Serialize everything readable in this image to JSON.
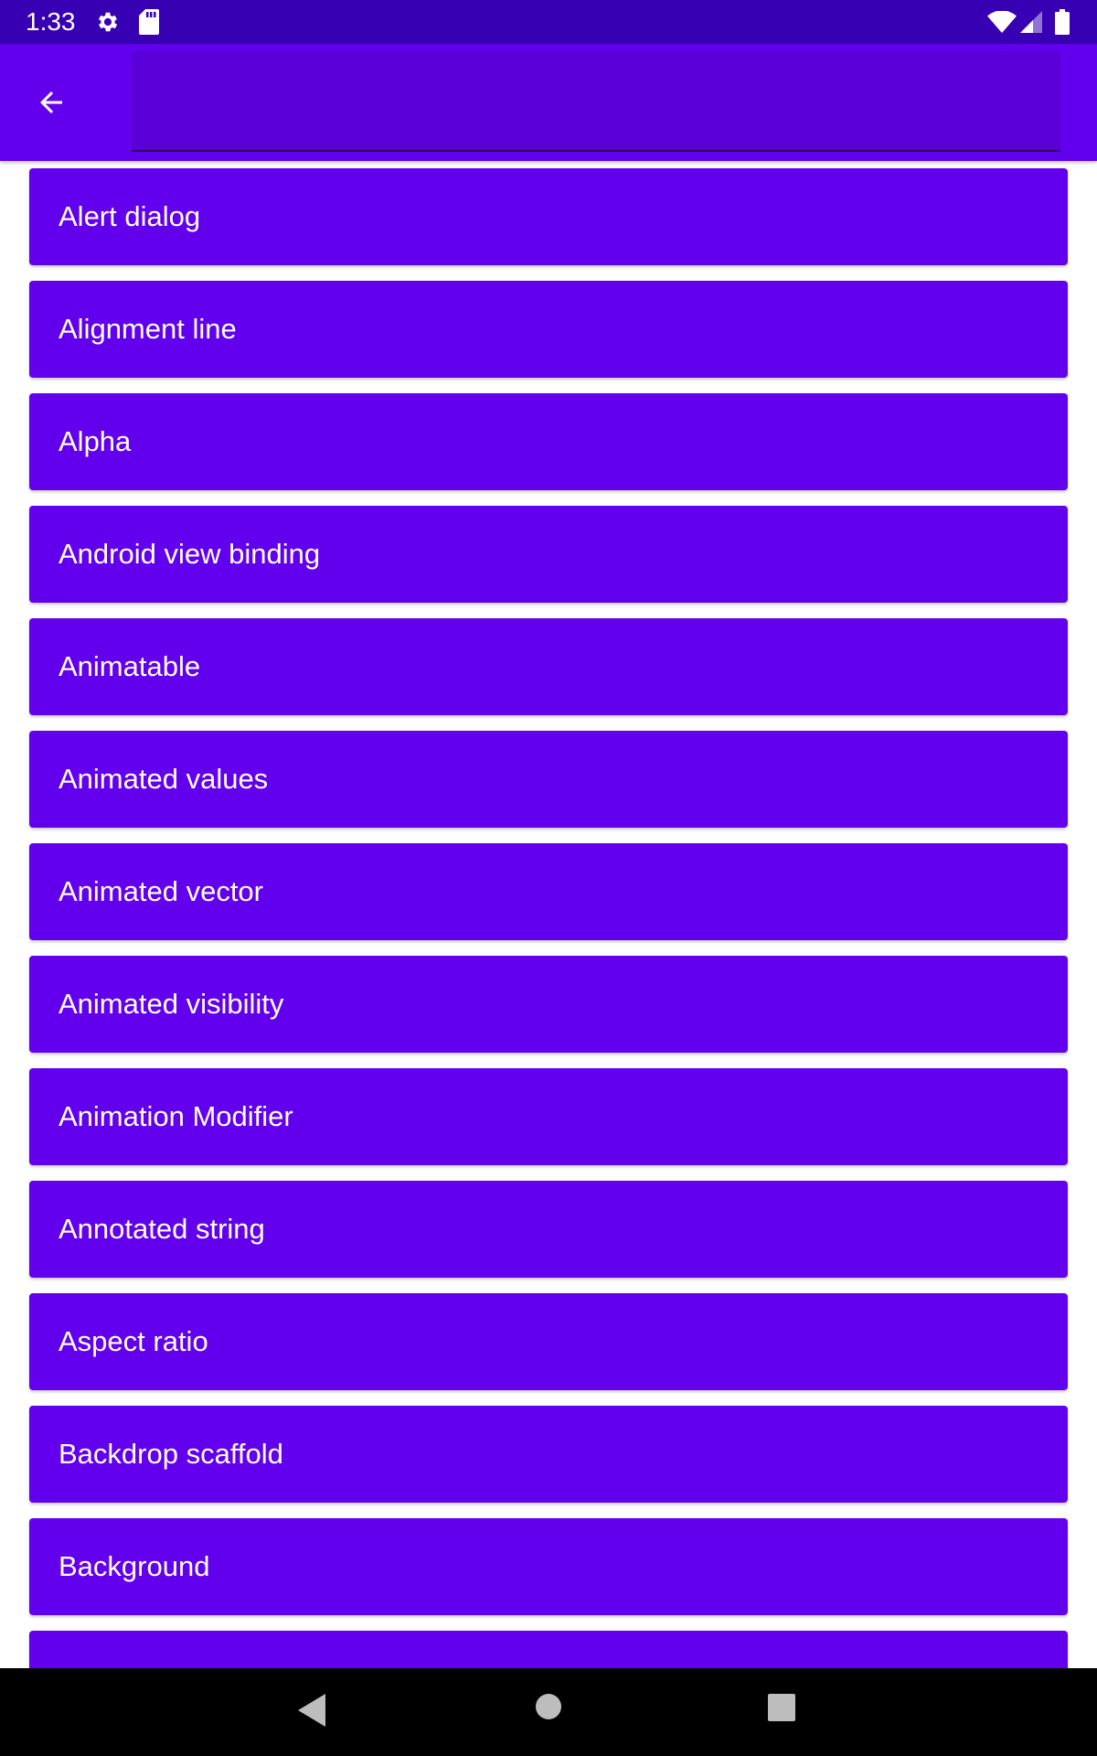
{
  "status_bar": {
    "time": "1:33",
    "icons": [
      "gear-icon",
      "sd-card-icon",
      "wifi-icon",
      "cell-signal-icon",
      "battery-icon"
    ]
  },
  "app_bar": {
    "back_icon": "arrow-back-icon",
    "search_value": "",
    "search_placeholder": ""
  },
  "list": {
    "items": [
      "Alert dialog",
      "Alignment line",
      "Alpha",
      "Android view binding",
      "Animatable",
      "Animated values",
      "Animated vector",
      "Animated visibility",
      "Animation Modifier",
      "Annotated string",
      "Aspect ratio",
      "Backdrop scaffold",
      "Background",
      ""
    ]
  },
  "nav_bar": {
    "icons": [
      "nav-back-icon",
      "nav-home-icon",
      "nav-recents-icon"
    ]
  },
  "colors": {
    "status_bar": "#3700b3",
    "app_bar": "#6200ee",
    "list_item": "#6200ee",
    "search_field": "#5800d6",
    "nav_bar": "#000000",
    "text": "#ffffff"
  }
}
